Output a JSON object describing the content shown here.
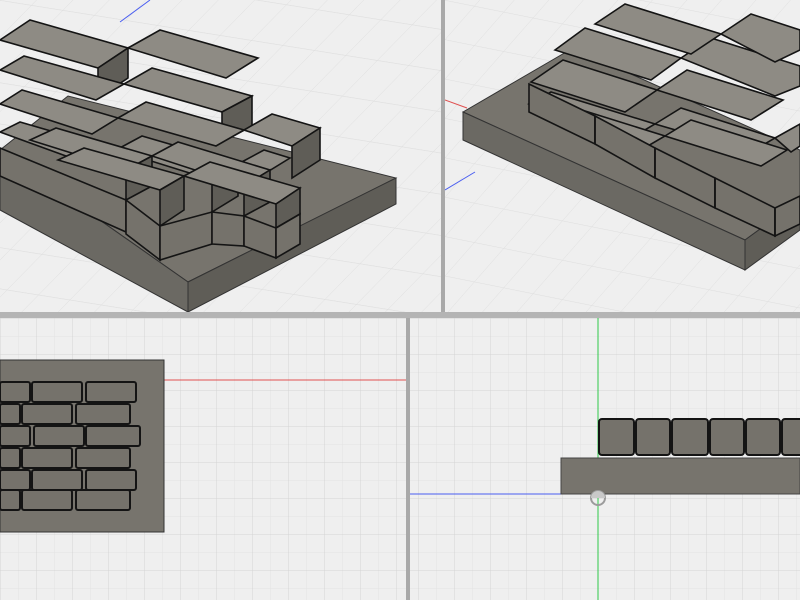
{
  "window": {
    "layout": "quad-view",
    "views": [
      {
        "id": "top-left",
        "projection": "isometric",
        "label": ""
      },
      {
        "id": "top-right",
        "projection": "isometric",
        "label": ""
      },
      {
        "id": "bottom-left",
        "projection": "top",
        "label": ""
      },
      {
        "id": "bottom-right",
        "projection": "front",
        "label": ""
      }
    ]
  },
  "model": {
    "name": "brick-wall-on-base-plate",
    "course_count": 6,
    "colors": {
      "viewport_bg": "#efefef",
      "grid_minor": "#e2e2e2",
      "grid_major": "#d2d2d2",
      "base_top": "#77746d",
      "base_front": "#5f5d57",
      "base_side": "#6b6963",
      "brick_face": "#75726b",
      "brick_top": "#8e8b84",
      "brick_edge": "#141414",
      "axis_red": "#e05050",
      "axis_blue": "#4a5ef0",
      "axis_green": "#2fc94a"
    }
  }
}
